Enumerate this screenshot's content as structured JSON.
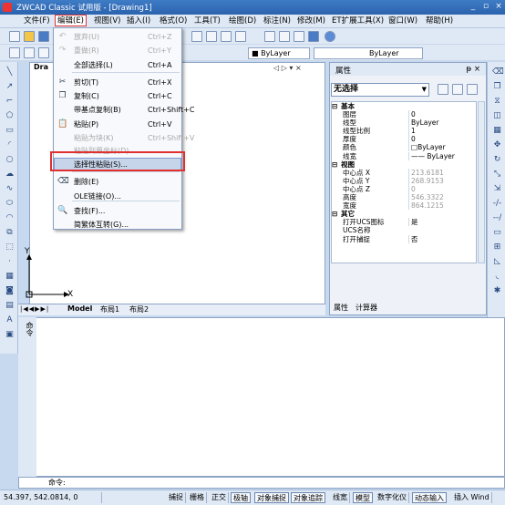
{
  "window": {
    "title": "ZWCAD Classic 试用版 - [Drawing1]",
    "min": "_",
    "max": "▫",
    "close": "×"
  },
  "menubar": {
    "items": [
      "文件(F)",
      "编辑(E)",
      "视图(V)",
      "插入(I)",
      "格式(O)",
      "工具(T)",
      "绘图(D)",
      "标注(N)",
      "修改(M)",
      "ET扩展工具(X)",
      "窗口(W)",
      "帮助(H)"
    ]
  },
  "toolbar": {
    "layer_combo": "ByLayer",
    "linetype_combo": "ByLayer",
    "color_combo": "■ ByLayer"
  },
  "edit_menu": {
    "items": [
      {
        "label": "放弃(U)",
        "shortcut": "Ctrl+Z",
        "disabled": true,
        "icon": "undo-icon",
        "glyph": "↶"
      },
      {
        "label": "重做(R)",
        "shortcut": "Ctrl+Y",
        "disabled": true,
        "icon": "redo-icon",
        "glyph": "↷"
      },
      {
        "label": "全部选择(L)",
        "shortcut": "Ctrl+A",
        "disabled": false,
        "icon": "",
        "glyph": ""
      },
      {
        "label": "剪切(T)",
        "shortcut": "Ctrl+X",
        "disabled": false,
        "icon": "scissors-icon",
        "glyph": "✂"
      },
      {
        "label": "复制(C)",
        "shortcut": "Ctrl+C",
        "disabled": false,
        "icon": "copy-icon",
        "glyph": "❐"
      },
      {
        "label": "带基点复制(B)",
        "shortcut": "Ctrl+Shift+C",
        "disabled": false,
        "icon": "",
        "glyph": ""
      },
      {
        "label": "粘贴(P)",
        "shortcut": "Ctrl+V",
        "disabled": false,
        "icon": "paste-icon",
        "glyph": "📋"
      },
      {
        "label": "粘贴为块(K)",
        "shortcut": "Ctrl+Shift+V",
        "disabled": true,
        "icon": "",
        "glyph": ""
      },
      {
        "label": "粘贴到原坐标(D)",
        "shortcut": "",
        "disabled": true,
        "icon": "",
        "glyph": ""
      },
      {
        "label": "选择性粘贴(S)...",
        "shortcut": "",
        "disabled": false,
        "icon": "",
        "glyph": ""
      },
      {
        "label": "删除(E)",
        "shortcut": "",
        "disabled": false,
        "icon": "eraser-icon",
        "glyph": "⌫"
      },
      {
        "label": "OLE链接(O)...",
        "shortcut": "",
        "disabled": false,
        "icon": "",
        "glyph": ""
      },
      {
        "label": "查找(F)...",
        "shortcut": "",
        "disabled": false,
        "icon": "find-icon",
        "glyph": "🔍"
      },
      {
        "label": "简繁体互转(G)...",
        "shortcut": "",
        "disabled": false,
        "icon": "",
        "glyph": ""
      }
    ]
  },
  "drawing": {
    "tab_label": "Dra",
    "header_controls": "◁ ▷ ▾ ×",
    "axis_x": "X",
    "axis_y": "Y"
  },
  "layout_tabs": [
    "Model",
    "布局1",
    "布局2"
  ],
  "properties": {
    "title": "属性",
    "pin": "ᵽ ×",
    "selection": "无选择",
    "rows": [
      {
        "type": "sec",
        "k": "基本"
      },
      {
        "k": "图层",
        "v": "0"
      },
      {
        "k": "线型",
        "v": "ByLayer"
      },
      {
        "k": "线型比例",
        "v": "1"
      },
      {
        "k": "厚度",
        "v": "0"
      },
      {
        "k": "颜色",
        "v": "□ByLayer"
      },
      {
        "k": "线宽",
        "v": "—— ByLayer"
      },
      {
        "type": "sec",
        "k": "视图"
      },
      {
        "k": "中心点 X",
        "v": "213.6181",
        "dim": true
      },
      {
        "k": "中心点 Y",
        "v": "268.9153",
        "dim": true
      },
      {
        "k": "中心点 Z",
        "v": "0",
        "dim": true
      },
      {
        "k": "高度",
        "v": "546.3322",
        "dim": true
      },
      {
        "k": "宽度",
        "v": "864.1215",
        "dim": true
      },
      {
        "type": "sec",
        "k": "其它"
      },
      {
        "k": "打开UCS图标",
        "v": "是"
      },
      {
        "k": "UCS名称",
        "v": ""
      },
      {
        "k": "打开捕捉",
        "v": "否"
      }
    ],
    "tabs": [
      "属性",
      "计算器"
    ]
  },
  "command": {
    "side_label": "命令",
    "prompt": "命令:"
  },
  "status": {
    "coords": "54.397, 542.0814, 0",
    "toggles": [
      "捕捉",
      "栅格",
      "正交",
      "极轴",
      "对象捕捉",
      "对象追踪",
      "线宽",
      "模型",
      "数字化仪",
      "动态输入",
      "插入 Wind"
    ]
  }
}
